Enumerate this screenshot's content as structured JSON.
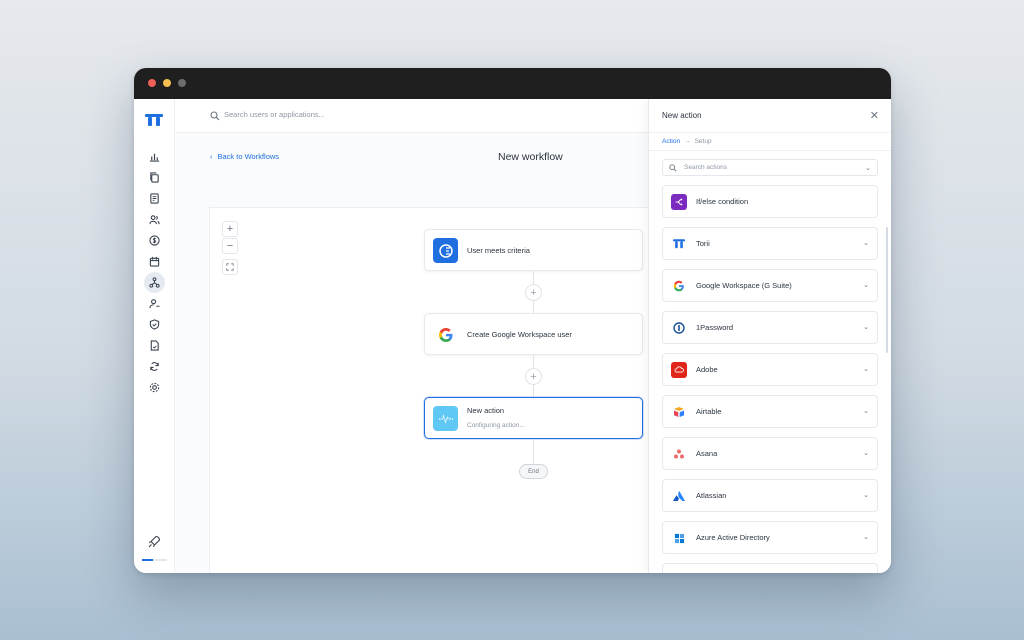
{
  "window": {
    "controls": [
      "close",
      "minimize",
      "zoom"
    ]
  },
  "sidebar": {
    "logo": "torii-logo",
    "items": [
      {
        "icon": "bar-chart-icon",
        "name": "nav-insights"
      },
      {
        "icon": "copy-icon",
        "name": "nav-applications"
      },
      {
        "icon": "document-icon",
        "name": "nav-contracts"
      },
      {
        "icon": "users-icon",
        "name": "nav-users"
      },
      {
        "icon": "dollar-icon",
        "name": "nav-expenses"
      },
      {
        "icon": "calendar-icon",
        "name": "nav-renewals"
      },
      {
        "icon": "workflow-icon",
        "name": "nav-workflows",
        "active": true
      },
      {
        "icon": "user-minus-icon",
        "name": "nav-offboarding"
      },
      {
        "icon": "shield-icon",
        "name": "nav-security"
      },
      {
        "icon": "file-icon",
        "name": "nav-reports"
      },
      {
        "icon": "sync-icon",
        "name": "nav-integrations"
      },
      {
        "icon": "gear-icon",
        "name": "nav-settings"
      }
    ],
    "onboarding_progress": 0.45
  },
  "search": {
    "placeholder": "Search users or applications..."
  },
  "header": {
    "back_label": "Back to Workflows",
    "title": "New workflow"
  },
  "canvas": {
    "zoom_in": "+",
    "zoom_out": "−",
    "fit": "fit-screen",
    "nodes": [
      {
        "title": "User meets criteria",
        "icon": "trigger-icon"
      },
      {
        "title": "Create Google Workspace user",
        "icon": "google-icon"
      },
      {
        "title": "New action",
        "subtitle": "Configuring action...",
        "icon": "action-pulse-icon"
      }
    ],
    "end_label": "End"
  },
  "panel": {
    "title": "New action",
    "steps": {
      "active": "Action",
      "arrow": "→",
      "next": "Setup"
    },
    "search_placeholder": "Search actions",
    "actions": [
      {
        "label": "If/else condition",
        "icon": "branch-icon",
        "color": "#7b2cbf",
        "expandable": false
      },
      {
        "label": "Torii",
        "icon": "torii-icon",
        "color": "#1f6fe0",
        "expandable": true
      },
      {
        "label": "Google Workspace (G Suite)",
        "icon": "google-icon",
        "color": "#4285f4",
        "expandable": true
      },
      {
        "label": "1Password",
        "icon": "onepassword-icon",
        "color": "#1a4f9c",
        "expandable": true
      },
      {
        "label": "Adobe",
        "icon": "adobe-icon",
        "color": "#e1251b",
        "expandable": true
      },
      {
        "label": "Airtable",
        "icon": "airtable-icon",
        "color": "#f9a826",
        "expandable": true
      },
      {
        "label": "Asana",
        "icon": "asana-icon",
        "color": "#f06a6a",
        "expandable": true
      },
      {
        "label": "Atlassian",
        "icon": "atlassian-icon",
        "color": "#2684ff",
        "expandable": true
      },
      {
        "label": "Azure Active Directory",
        "icon": "azure-icon",
        "color": "#0078d4",
        "expandable": true
      }
    ]
  }
}
